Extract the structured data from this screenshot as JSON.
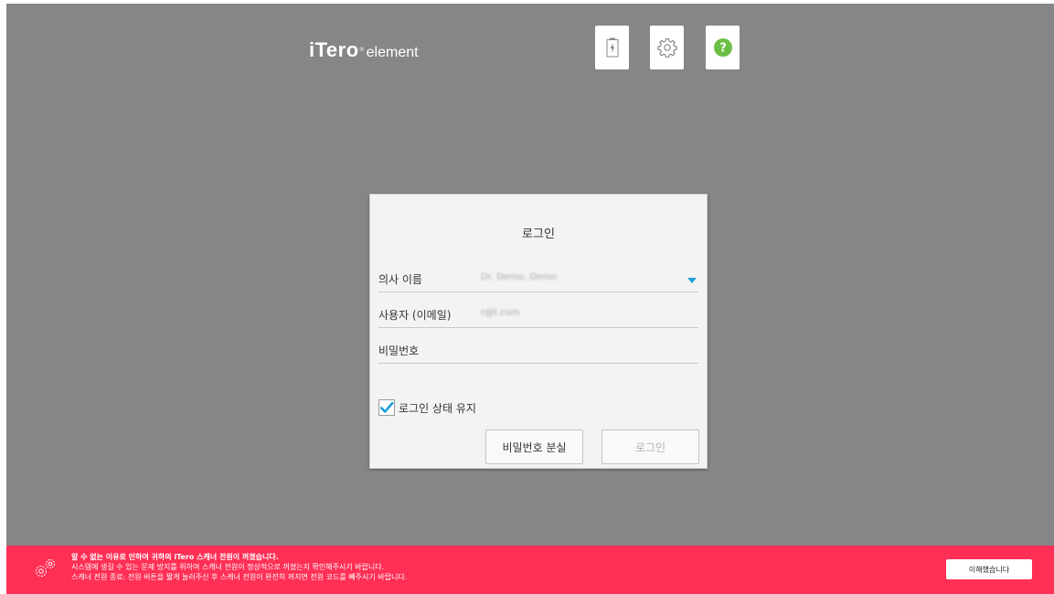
{
  "header": {
    "logo_brand": "iTero",
    "logo_reg": "®",
    "logo_sub": "element",
    "buttons": [
      {
        "name": "battery",
        "icon": "battery-icon"
      },
      {
        "name": "settings",
        "icon": "gear-icon"
      },
      {
        "name": "help",
        "icon": "help-icon"
      }
    ]
  },
  "login": {
    "title": "로그인",
    "doctor_label": "의사 이름",
    "doctor_value": "Dr. Demo, Demo",
    "user_label": "사용자 (이메일)",
    "user_value": "r@t.com",
    "password_label": "비밀번호",
    "password_value": "",
    "keep_label": "로그인 상태 유지",
    "keep_checked": true,
    "forgot_button": "비밀번호 분실",
    "login_button": "로그인"
  },
  "banner": {
    "title": "알 수 없는 이유로 인하여 귀하의 iTero 스캐너 전원이 꺼졌습니다.",
    "line1": "시스템에 생길 수 있는 문제 방지를 위하여 스캐너 전원이 정상적으로 꺼졌는지 확인해주시기 바랍니다.",
    "line2": "스캐너 전원 종료: 전원 버튼을 짧게 눌러주신 후 스캐너 전원이 완전히 꺼지면 전원 코드를 빼주시기 바랍니다.",
    "ack_button": "이해했습니다",
    "icon": "gears-icon"
  },
  "colors": {
    "background": "#858688",
    "banner": "#ff2f55",
    "help_green": "#6dbe45",
    "accent_blue": "#1e9fd8"
  }
}
